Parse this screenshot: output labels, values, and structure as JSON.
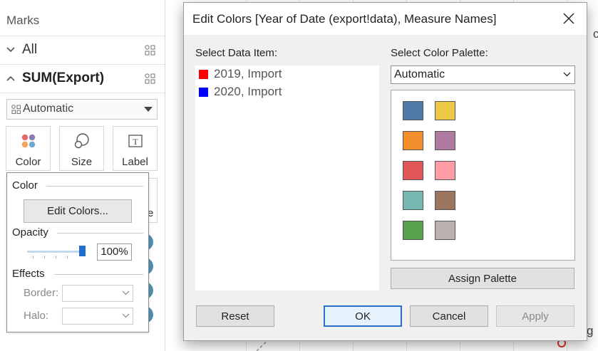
{
  "marks": {
    "title": "Marks",
    "card_all": "All",
    "card_sum": "SUM(Export)",
    "mark_type": "Automatic",
    "buttons": {
      "color": "Color",
      "size": "Size",
      "label": "Label"
    }
  },
  "color_popover": {
    "color_heading": "Color",
    "edit_colors": "Edit Colors...",
    "opacity_heading": "Opacity",
    "opacity_value": "100%",
    "opacity_level": 1.0,
    "effects_heading": "Effects",
    "border_label": "Border:",
    "halo_label": "Halo:"
  },
  "dialog": {
    "title": "Edit Colors [Year of Date (export!data), Measure Names]",
    "select_data_item_label": "Select Data Item:",
    "data_items": [
      {
        "label": "2019, Import",
        "color": "#ff0000"
      },
      {
        "label": "2020, Import",
        "color": "#0000ff"
      }
    ],
    "select_palette_label": "Select Color Palette:",
    "palette_value": "Automatic",
    "palette_colors": [
      "#4e79a7",
      "#edc948",
      "#f28e2b",
      "#b07aa1",
      "#e15759",
      "#ff9da7",
      "#76b7b2",
      "#9c755f",
      "#59a14f",
      "#bab0ac"
    ],
    "assign_palette": "Assign Palette",
    "reset": "Reset",
    "ok": "OK",
    "cancel": "Cancel",
    "apply": "Apply"
  },
  "canvas": {
    "edge_text_top": "c",
    "edge_text_bottom": "g"
  },
  "colors": {
    "accent": "#2a70c8",
    "mark_circle": "#4e8fb0"
  }
}
